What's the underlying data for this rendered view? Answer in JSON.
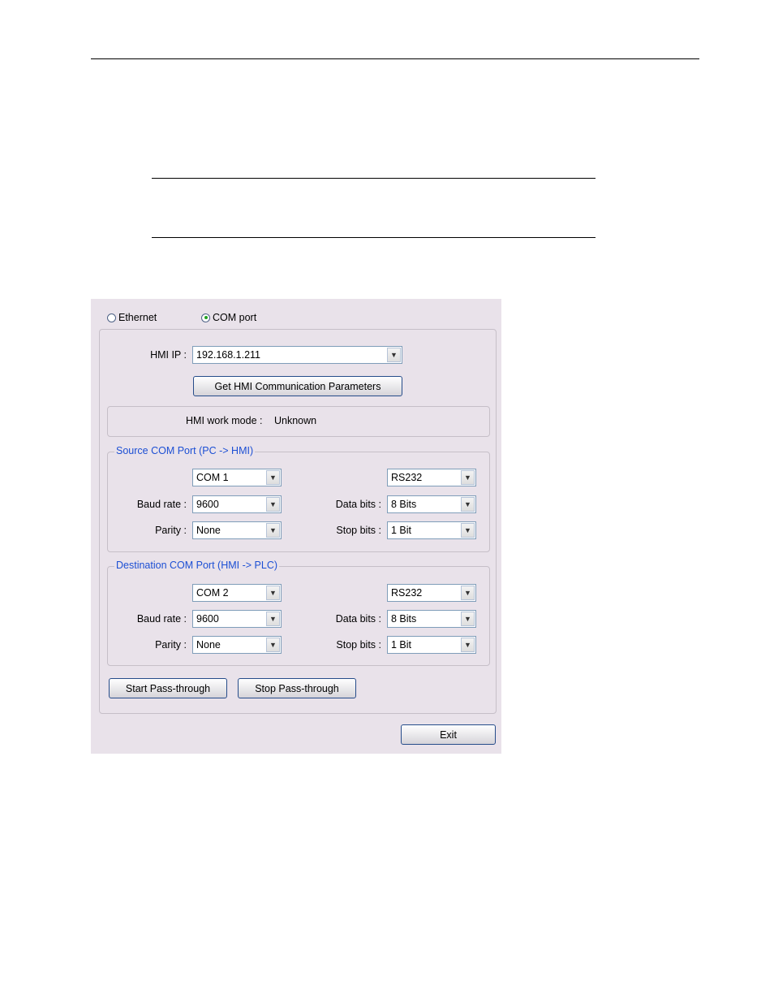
{
  "connection": {
    "options": [
      {
        "label": "Ethernet",
        "selected": false
      },
      {
        "label": "COM port",
        "selected": true
      }
    ]
  },
  "hmi_ip": {
    "label": "HMI IP :",
    "value": "192.168.1.211"
  },
  "get_params_button": "Get HMI  Communication Parameters",
  "work_mode": {
    "label": "HMI work mode :",
    "value": "Unknown"
  },
  "source": {
    "title": "Source COM Port (PC -> HMI)",
    "port": "COM 1",
    "interface": "RS232",
    "baud_label": "Baud rate :",
    "baud": "9600",
    "data_bits_label": "Data bits :",
    "data_bits": "8 Bits",
    "parity_label": "Parity :",
    "parity": "None",
    "stop_bits_label": "Stop bits :",
    "stop_bits": "1 Bit"
  },
  "destination": {
    "title": "Destination COM Port (HMI -> PLC)",
    "port": "COM 2",
    "interface": "RS232",
    "baud_label": "Baud rate :",
    "baud": "9600",
    "data_bits_label": "Data bits :",
    "data_bits": "8 Bits",
    "parity_label": "Parity :",
    "parity": "None",
    "stop_bits_label": "Stop bits :",
    "stop_bits": "1 Bit"
  },
  "buttons": {
    "start": "Start Pass-through",
    "stop": "Stop Pass-through",
    "exit": "Exit"
  }
}
